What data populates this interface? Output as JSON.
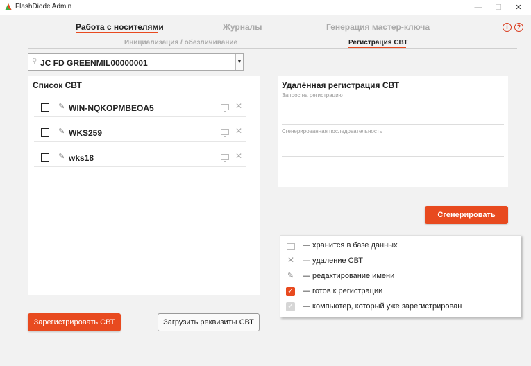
{
  "window": {
    "title": "FlashDiode Admin",
    "minimize": "—",
    "maximize": "☐",
    "close": "✕"
  },
  "tabs": [
    {
      "label": "Работа с носителями"
    },
    {
      "label": "Журналы"
    },
    {
      "label": "Генерация мастер-ключа"
    }
  ],
  "subtabs": [
    {
      "label": "Инициализация / обезличивание"
    },
    {
      "label": "Регистрация СВТ"
    }
  ],
  "device": {
    "value": "JC FD GREENMIL00000001"
  },
  "svt_list": {
    "title": "Список СВТ",
    "items": [
      {
        "name": "WIN-NQKOPMBEOA5",
        "checked": false
      },
      {
        "name": "WKS259",
        "checked": false
      },
      {
        "name": "wks18",
        "checked": false
      }
    ]
  },
  "buttons": {
    "register": "Зарегистрировать СВТ",
    "load": "Загрузить реквизиты СВТ",
    "generate": "Сгенерировать"
  },
  "remote": {
    "title": "Удалённая регистрация СВТ",
    "request_label": "Запрос на регистрацию",
    "generated_label": "Сгенерированная последовательность"
  },
  "legend": [
    {
      "icon": "monitor-icon",
      "text": "— хранится в базе данных"
    },
    {
      "icon": "delete-icon",
      "text": "— удаление СВТ"
    },
    {
      "icon": "pencil-icon",
      "text": "— редактирование имени"
    },
    {
      "icon": "checkbox-checked-icon",
      "text": "— готов к регистрации"
    },
    {
      "icon": "checkbox-disabled-icon",
      "text": "— компьютер, который уже зарегистрирован"
    }
  ],
  "colors": {
    "accent": "#e84a1f",
    "info": "#d9391b"
  }
}
